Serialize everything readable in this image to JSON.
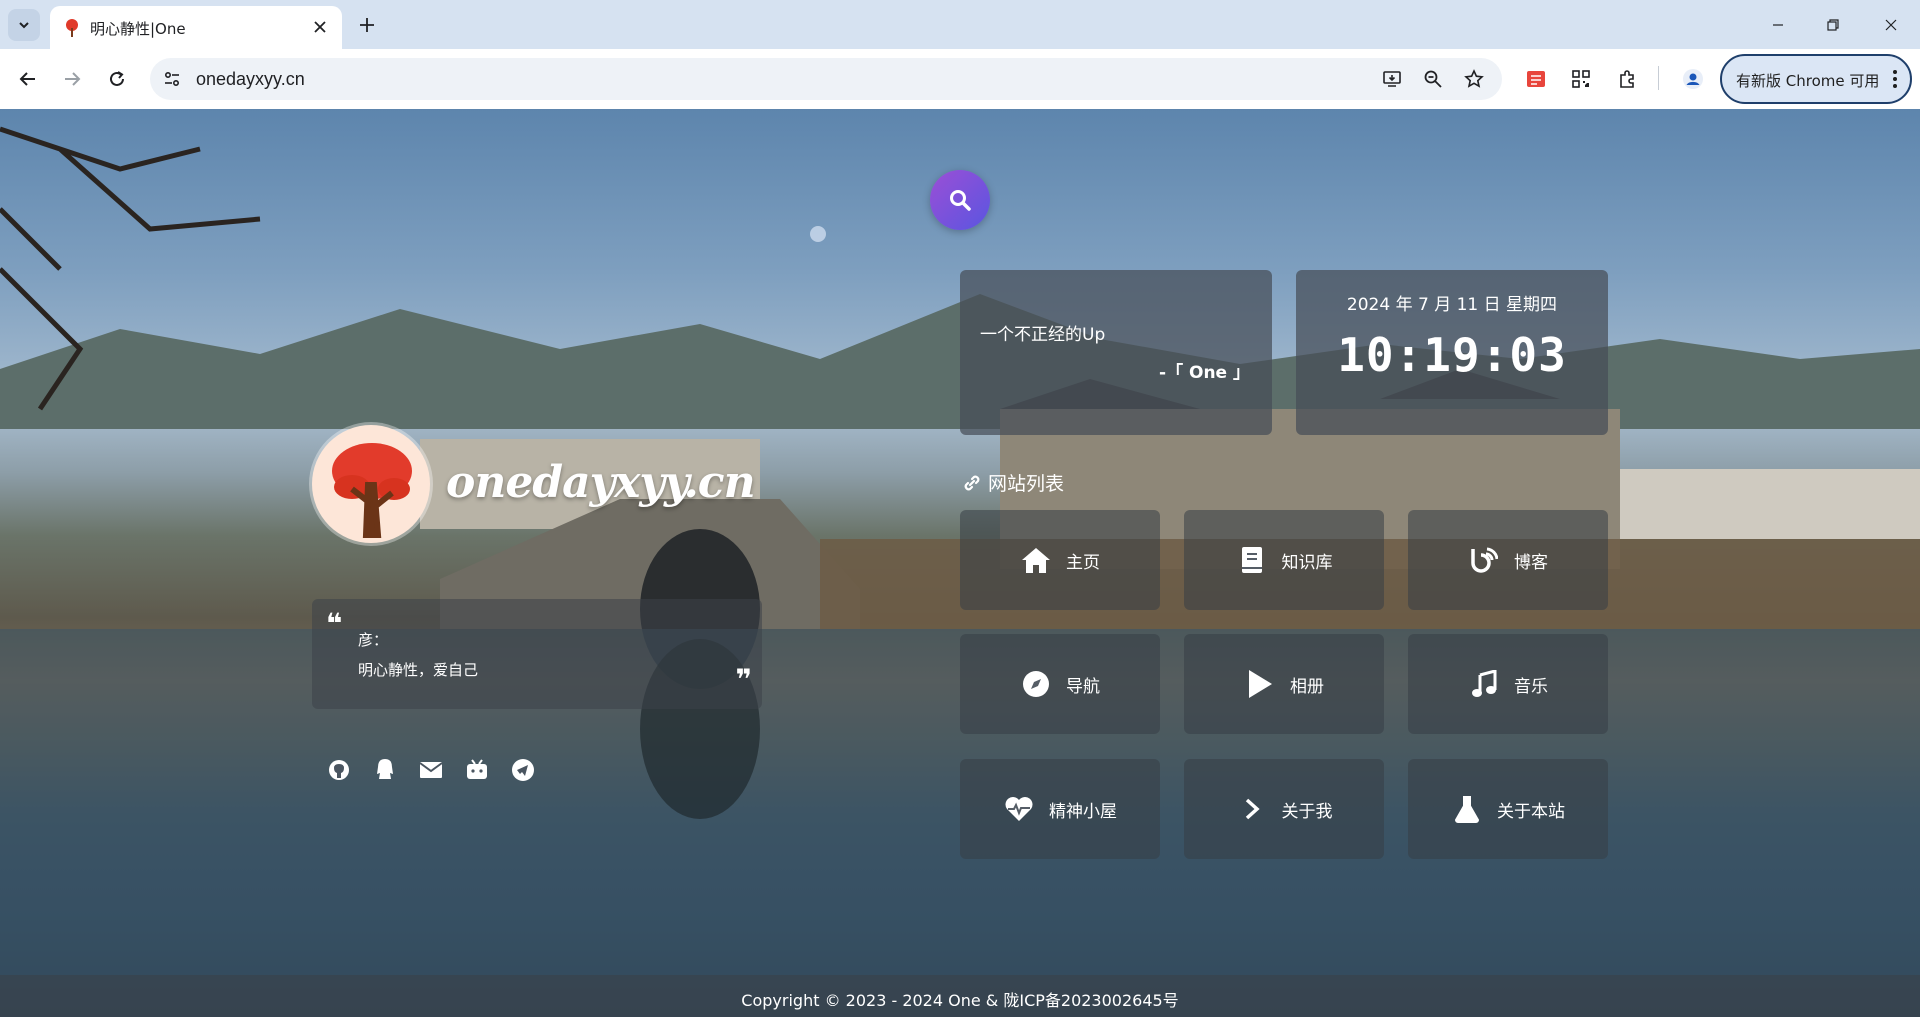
{
  "browser": {
    "tab_title": "明心静性|One",
    "url": "onedayxyy.cn",
    "update_label": "有新版 Chrome 可用"
  },
  "page": {
    "quote": {
      "text": "一个不正经的Up",
      "author": "-「 One 」"
    },
    "datetime": {
      "date": "2024 年 7 月 11 日 星期四",
      "time": "10:19:03"
    },
    "brand": "onedayxyy.cn",
    "motto": {
      "label": "彦：",
      "text": "明心静性，爱自己",
      "open_quote": "❝",
      "close_quote": "❞"
    },
    "section_title": "网站列表",
    "nav": [
      {
        "label": "主页",
        "icon": "home-icon"
      },
      {
        "label": "知识库",
        "icon": "book-icon"
      },
      {
        "label": "博客",
        "icon": "blog-icon"
      },
      {
        "label": "导航",
        "icon": "compass-icon"
      },
      {
        "label": "相册",
        "icon": "play-icon"
      },
      {
        "label": "音乐",
        "icon": "music-icon"
      },
      {
        "label": "精神小屋",
        "icon": "heartbeat-icon"
      },
      {
        "label": "关于我",
        "icon": "chevron-right-icon"
      },
      {
        "label": "关于本站",
        "icon": "flask-icon"
      }
    ],
    "social_icons": [
      "github-icon",
      "qq-icon",
      "mail-icon",
      "bilibili-icon",
      "telegram-icon"
    ],
    "footer": "Copyright © 2023 - 2024 One &  陇ICP备2023002645号"
  }
}
